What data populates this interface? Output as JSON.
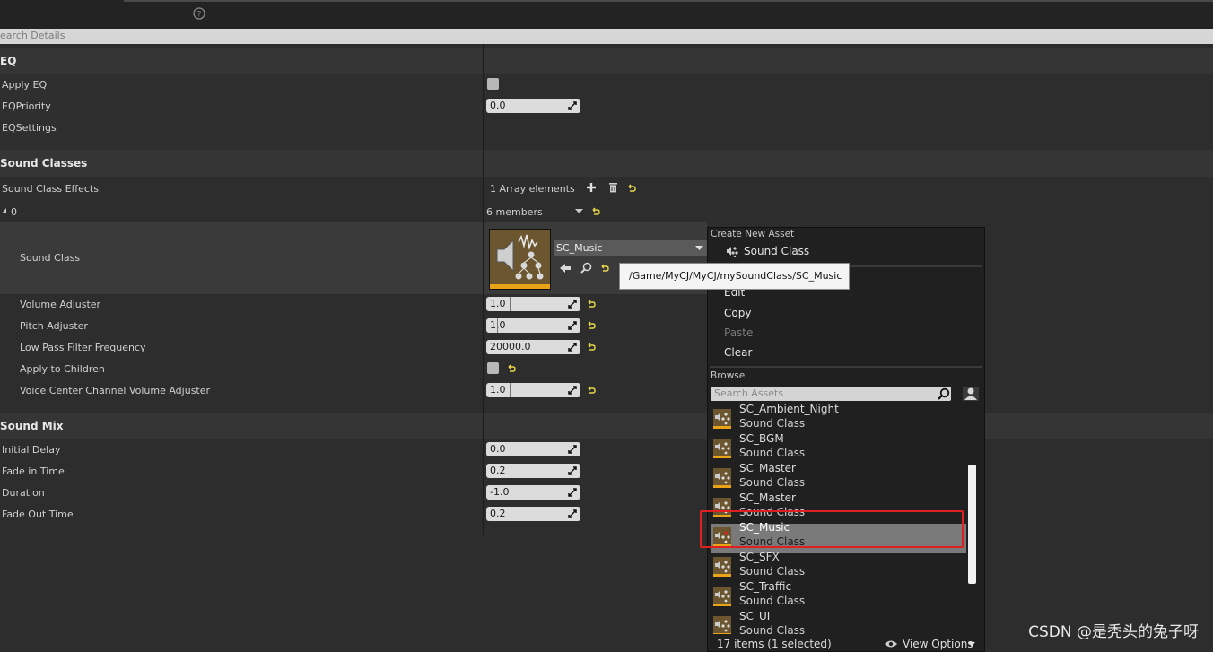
{
  "search": {
    "placeholder": "earch Details"
  },
  "eq": {
    "title": "EQ",
    "apply_eq": "Apply EQ",
    "priority_label": "EQPriority",
    "priority_value": "0.0",
    "settings_label": "EQSettings"
  },
  "sound_classes": {
    "title": "Sound Classes",
    "effects_label": "Sound Class Effects",
    "array_elements": "1 Array elements",
    "index_label": "0",
    "members": "6 members",
    "sound_class_label": "Sound Class",
    "sound_class_value": "SC_Music",
    "volume_label": "Volume Adjuster",
    "volume_value": "1.0",
    "pitch_label": "Pitch Adjuster",
    "pitch_value": "1.0",
    "lowpass_label": "Low Pass Filter Frequency",
    "lowpass_value": "20000.0",
    "apply_children_label": "Apply to Children",
    "voice_center_label": "Voice Center Channel Volume Adjuster",
    "voice_center_value": "1.0"
  },
  "sound_mix": {
    "title": "Sound Mix",
    "initial_delay_label": "Initial Delay",
    "initial_delay_value": "0.0",
    "fade_in_label": "Fade in Time",
    "fade_in_value": "0.2",
    "duration_label": "Duration",
    "duration_value": "-1.0",
    "fade_out_label": "Fade Out Time",
    "fade_out_value": "0.2"
  },
  "popup": {
    "create_header": "Create New Asset",
    "create_item": "Sound Class",
    "edit": "Edit",
    "copy": "Copy",
    "paste": "Paste",
    "clear": "Clear",
    "browse_header": "Browse",
    "search_placeholder": "Search Assets",
    "assets": [
      {
        "name": "SC_Ambient_Night",
        "type": "Sound Class"
      },
      {
        "name": "SC_BGM",
        "type": "Sound Class"
      },
      {
        "name": "SC_Master",
        "type": "Sound Class"
      },
      {
        "name": "SC_Master",
        "type": "Sound Class"
      },
      {
        "name": "SC_Music",
        "type": "Sound Class"
      },
      {
        "name": "SC_SFX",
        "type": "Sound Class"
      },
      {
        "name": "SC_Traffic",
        "type": "Sound Class"
      },
      {
        "name": "SC_UI",
        "type": "Sound Class"
      }
    ],
    "status": "17 items (1 selected)",
    "view_options": "View Options"
  },
  "tooltip": {
    "path": "/Game/MyCJ/MyCJ/mySoundClass/SC_Music"
  },
  "watermark": "CSDN @是秃头的兔子呀",
  "colors": {
    "accent_orange": "#e8a317",
    "selection_red": "#e02020",
    "reset_yellow": "#e8d84a"
  }
}
